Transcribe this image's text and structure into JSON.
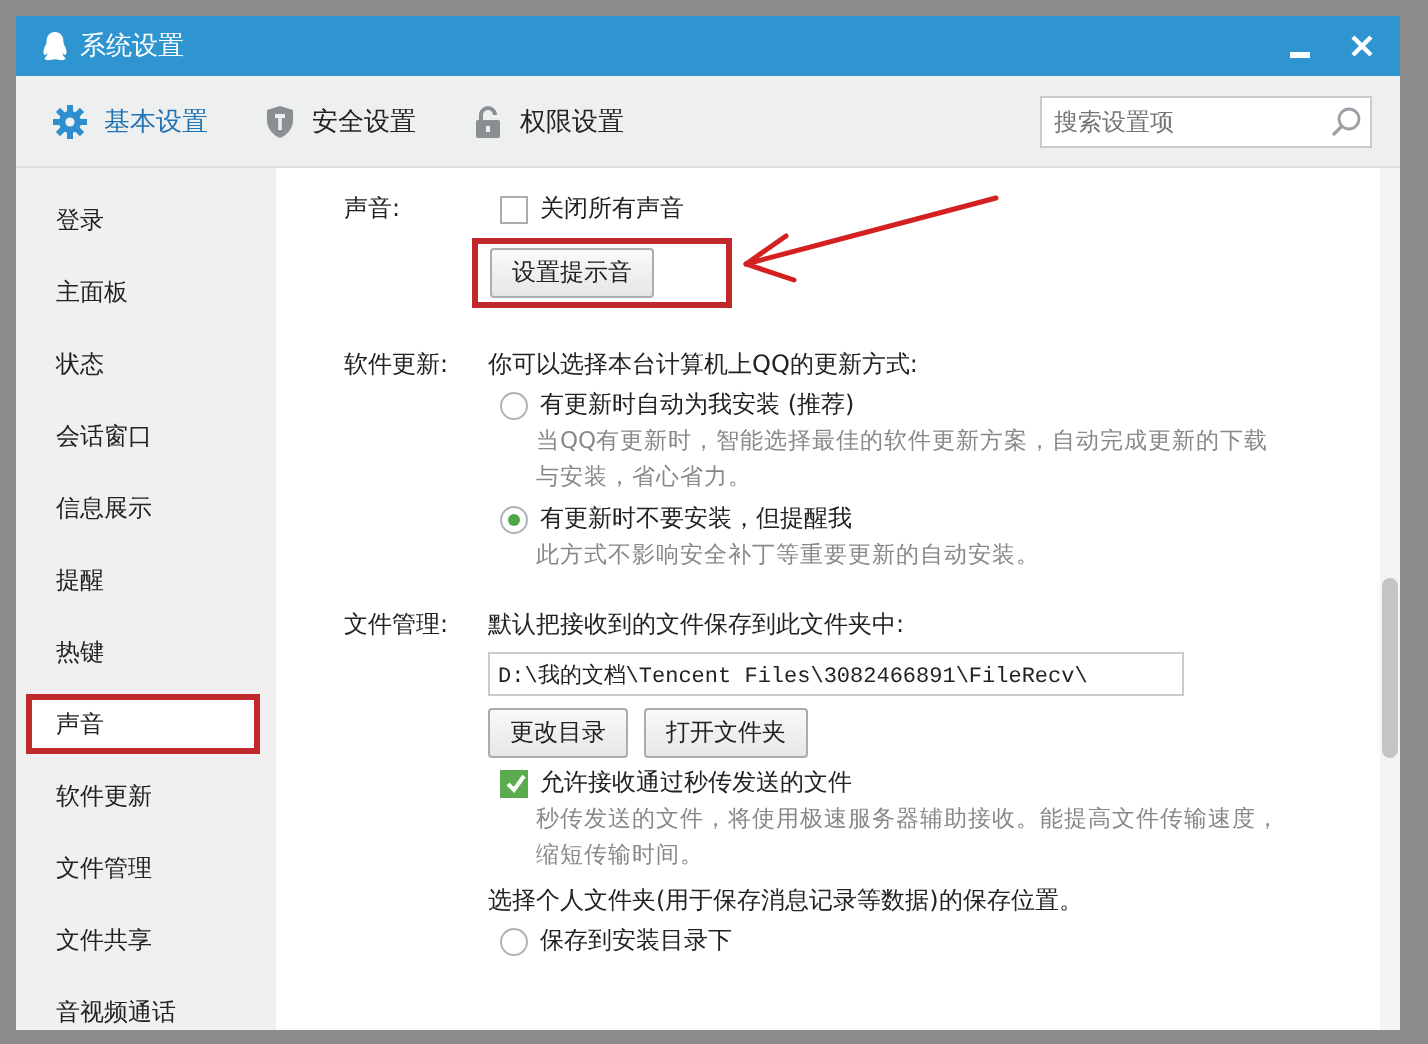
{
  "window": {
    "title": "系统设置"
  },
  "tabs": [
    {
      "label": "基本设置",
      "kind": "gear",
      "selected": true
    },
    {
      "label": "安全设置",
      "kind": "shield",
      "selected": false
    },
    {
      "label": "权限设置",
      "kind": "lock",
      "selected": false
    }
  ],
  "search": {
    "placeholder": "搜索设置项"
  },
  "sidebar": {
    "items": [
      {
        "label": "登录",
        "selected": false
      },
      {
        "label": "主面板",
        "selected": false
      },
      {
        "label": "状态",
        "selected": false
      },
      {
        "label": "会话窗口",
        "selected": false
      },
      {
        "label": "信息展示",
        "selected": false
      },
      {
        "label": "提醒",
        "selected": false
      },
      {
        "label": "热键",
        "selected": false
      },
      {
        "label": "声音",
        "selected": true
      },
      {
        "label": "软件更新",
        "selected": false
      },
      {
        "label": "文件管理",
        "selected": false
      },
      {
        "label": "文件共享",
        "selected": false
      },
      {
        "label": "音视频通话",
        "selected": false
      }
    ]
  },
  "sound": {
    "label": "声音:",
    "mute_all": {
      "label": "关闭所有声音",
      "checked": false
    },
    "button": {
      "label": "设置提示音",
      "annotated": true
    }
  },
  "update": {
    "label": "软件更新:",
    "intro": "你可以选择本台计算机上QQ的更新方式:",
    "options": [
      {
        "label": "有更新时自动为我安装 (推荐)",
        "description": "当QQ有更新时，智能选择最佳的软件更新方案，自动完成更新的下载与安装，省心省力。",
        "selected": false
      },
      {
        "label": "有更新时不要安装，但提醒我",
        "description": "此方式不影响安全补丁等重要更新的自动安装。",
        "selected": true
      }
    ]
  },
  "files": {
    "label": "文件管理:",
    "intro": "默认把接收到的文件保存到此文件夹中:",
    "path": "D:\\我的文档\\Tencent Files\\3082466891\\FileRecv\\",
    "buttons": [
      "更改目录",
      "打开文件夹"
    ],
    "fast_receive": {
      "label": "允许接收通过秒传发送的文件",
      "description": "秒传发送的文件，将使用极速服务器辅助接收。能提高文件传输速度，缩短传输时间。",
      "checked": true
    },
    "personal_prompt": "选择个人文件夹(用于保存消息记录等数据)的保存位置。",
    "personal_options": [
      {
        "label": "保存到安装目录下",
        "selected": false
      }
    ]
  }
}
